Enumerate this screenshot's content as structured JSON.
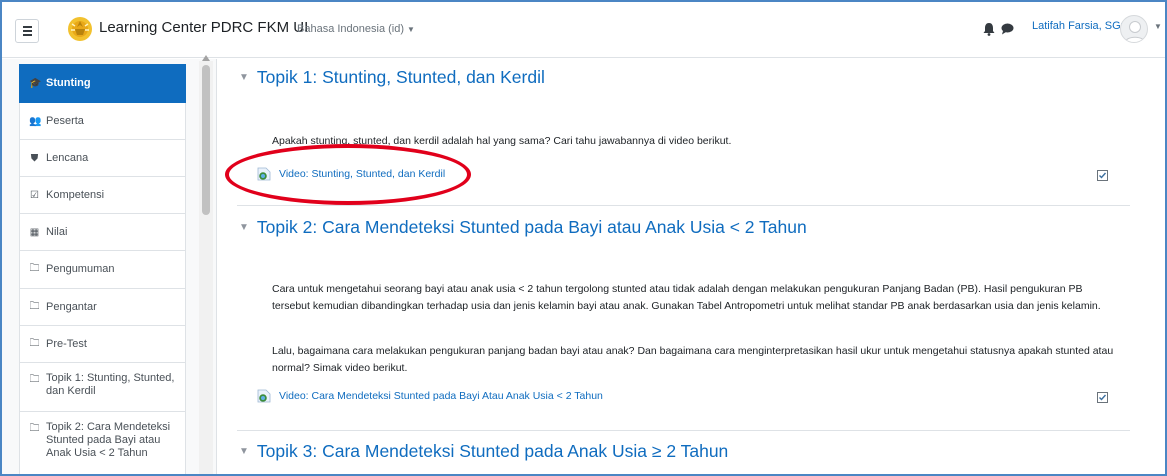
{
  "navbar": {
    "site_name": "Learning Center PDRC FKM UI",
    "language": "Bahasa Indonesia ‎(id)‎",
    "user_name": "Latifah Farsia, SGz",
    "icons": [
      "menu-icon",
      "university-logo",
      "bell-icon",
      "chat-icon",
      "user-avatar",
      "chevron-down-icon"
    ]
  },
  "sidebar": {
    "items": [
      {
        "label": "Stunting",
        "icon": "graduation-cap-icon",
        "active": true
      },
      {
        "label": "Peserta",
        "icon": "users-icon"
      },
      {
        "label": "Lencana",
        "icon": "shield-icon"
      },
      {
        "label": "Kompetensi",
        "icon": "checkbox-icon"
      },
      {
        "label": "Nilai",
        "icon": "table-icon"
      },
      {
        "label": "Pengumuman",
        "icon": "folder-icon"
      },
      {
        "label": "Pengantar",
        "icon": "folder-icon"
      },
      {
        "label": "Pre-Test",
        "icon": "folder-icon"
      },
      {
        "label": "Topik 1: Stunting, Stunted, dan Kerdil",
        "icon": "folder-icon"
      },
      {
        "label": "Topik 2: Cara Mendeteksi Stunted pada Bayi atau Anak Usia < 2 Tahun",
        "icon": "folder-icon"
      }
    ]
  },
  "sections": [
    {
      "title": "Topik 1: Stunting, Stunted, dan Kerdil",
      "text": "Apakah stunting, stunted, dan kerdil adalah hal yang sama? Cari tahu jawabannya di video berikut.",
      "activity": "Video: Stunting, Stunted, dan Kerdil"
    },
    {
      "title": "Topik 2: Cara Mendeteksi Stunted pada Bayi atau Anak Usia < 2 Tahun",
      "text1": "Cara untuk mengetahui seorang bayi atau anak usia < 2 tahun tergolong stunted atau tidak adalah dengan melakukan pengukuran Panjang Badan (PB). Hasil pengukuran PB tersebut kemudian dibandingkan terhadap usia dan jenis kelamin bayi atau anak. Gunakan Tabel Antropometri untuk melihat standar PB anak berdasarkan usia dan jenis kelamin.",
      "text2": "Lalu, bagaimana cara melakukan pengukuran panjang badan bayi atau anak? Dan bagaimana cara menginterpretasikan hasil ukur untuk mengetahui statusnya apakah stunted atau normal? Simak video berikut.",
      "activity": "Video: Cara Mendeteksi Stunted pada Bayi Atau Anak Usia < 2 Tahun"
    },
    {
      "title": "Topik 3: Cara Mendeteksi Stunted pada Anak Usia ≥ 2 Tahun"
    }
  ],
  "colors": {
    "brand": "#0f6cbf",
    "annotation": "#e1001b"
  }
}
